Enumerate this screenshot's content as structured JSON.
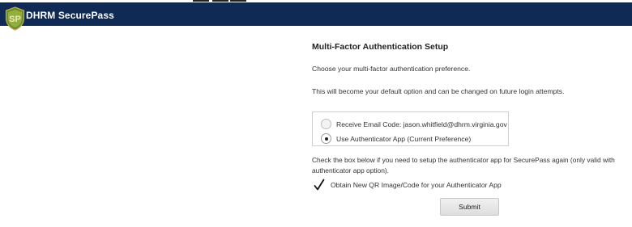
{
  "header": {
    "brand": "DHRM SecurePass",
    "logo_text": "SP",
    "bg_color": "#0f2a55"
  },
  "mfa": {
    "title": "Multi-Factor Authentication Setup",
    "intro": "Choose your multi-factor authentication preference.",
    "default_note": "This will become your default option and can be changed on future login attempts.",
    "options": [
      {
        "label": "Receive Email Code: jason.whitfield@dhrm.virginia.gov",
        "selected": false
      },
      {
        "label": "Use Authenticator App (Current Preference)",
        "selected": true
      }
    ],
    "reset_note": "Check the box below if you need to setup the authenticator app for SecurePass again (only valid with authenticator app option).",
    "checkbox_label": "Obtain New QR Image/Code for your Authenticator App",
    "checkbox_checked": true,
    "submit_label": "Submit"
  }
}
